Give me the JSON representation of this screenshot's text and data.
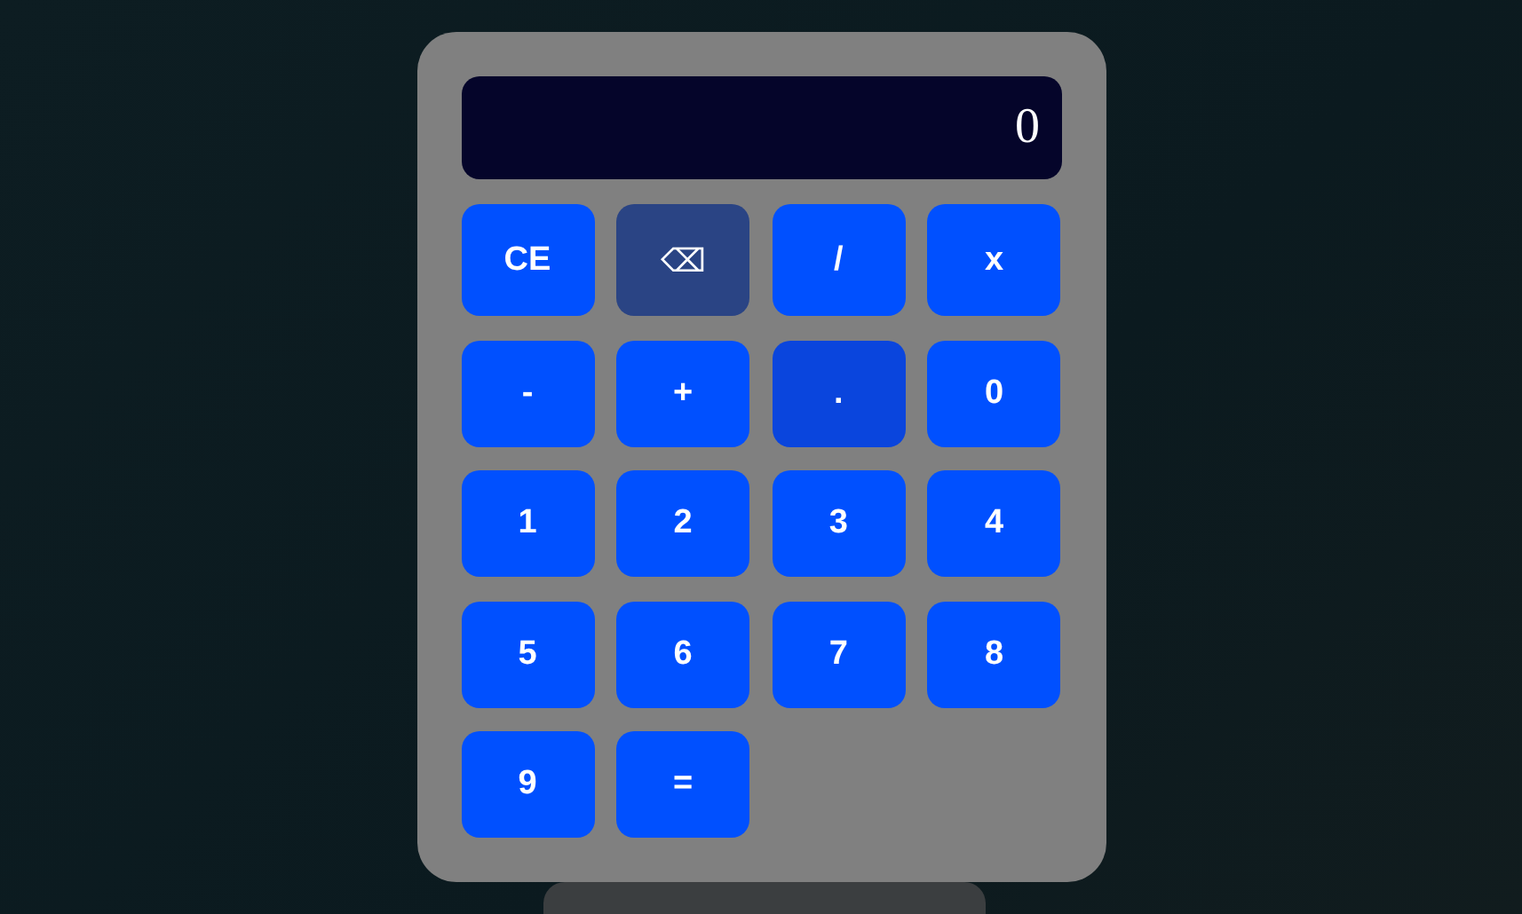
{
  "display": {
    "value": "0"
  },
  "buttons": [
    {
      "label": "CE",
      "kind": "key",
      "highlighted": false
    },
    {
      "label": "⌫",
      "kind": "delete",
      "highlighted": false
    },
    {
      "label": "/",
      "kind": "key",
      "highlighted": false
    },
    {
      "label": "x",
      "kind": "key",
      "highlighted": false
    },
    {
      "label": "-",
      "kind": "key",
      "highlighted": false
    },
    {
      "label": "+",
      "kind": "key",
      "highlighted": false
    },
    {
      "label": ".",
      "kind": "key",
      "highlighted": true
    },
    {
      "label": "0",
      "kind": "key",
      "highlighted": false
    },
    {
      "label": "1",
      "kind": "key",
      "highlighted": false
    },
    {
      "label": "2",
      "kind": "key",
      "highlighted": false
    },
    {
      "label": "3",
      "kind": "key",
      "highlighted": false
    },
    {
      "label": "4",
      "kind": "key",
      "highlighted": false
    },
    {
      "label": "5",
      "kind": "key",
      "highlighted": false
    },
    {
      "label": "6",
      "kind": "key",
      "highlighted": false
    },
    {
      "label": "7",
      "kind": "key",
      "highlighted": false
    },
    {
      "label": "8",
      "kind": "key",
      "highlighted": false
    },
    {
      "label": "9",
      "kind": "key",
      "highlighted": false
    },
    {
      "label": "=",
      "kind": "key",
      "highlighted": false
    }
  ]
}
